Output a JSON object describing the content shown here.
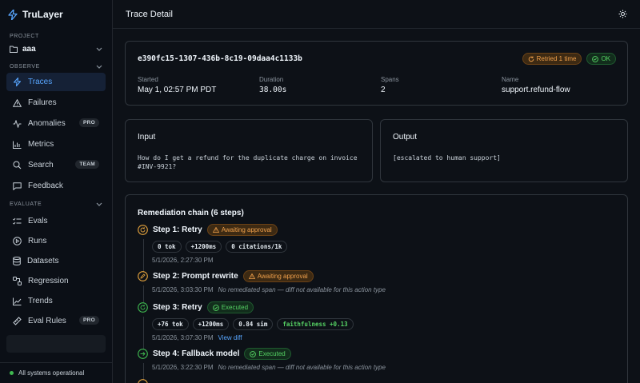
{
  "app": {
    "name": "TruLayer"
  },
  "sidebar": {
    "project_label": "PROJECT",
    "project_name": "aaa",
    "observe_label": "OBSERVE",
    "observe_items": [
      {
        "label": "Traces",
        "icon": "activity-icon"
      },
      {
        "label": "Failures",
        "icon": "warning-icon"
      },
      {
        "label": "Anomalies",
        "icon": "pulse-icon",
        "badge": "PRO"
      },
      {
        "label": "Metrics",
        "icon": "bar-chart-icon"
      },
      {
        "label": "Search",
        "icon": "search-icon",
        "badge": "TEAM"
      },
      {
        "label": "Feedback",
        "icon": "message-icon"
      }
    ],
    "evaluate_label": "EVALUATE",
    "evaluate_items": [
      {
        "label": "Evals",
        "icon": "list-icon"
      },
      {
        "label": "Runs",
        "icon": "play-icon"
      },
      {
        "label": "Datasets",
        "icon": "database-icon"
      },
      {
        "label": "Regression",
        "icon": "regression-icon"
      },
      {
        "label": "Trends",
        "icon": "trend-icon"
      },
      {
        "label": "Eval Rules",
        "icon": "ruler-icon",
        "badge": "PRO"
      }
    ],
    "status": "All systems operational"
  },
  "header": {
    "title": "Trace Detail",
    "theme_icon": "sun-icon"
  },
  "trace": {
    "id": "e390fc15-1307-436b-8c19-09daa4c1133b",
    "retried_badge": "Retried 1 time",
    "ok_badge": "OK",
    "started_label": "Started",
    "started_value": "May 1, 02:57 PM PDT",
    "duration_label": "Duration",
    "duration_value": "38.00s",
    "spans_label": "Spans",
    "spans_value": "2",
    "name_label": "Name",
    "name_value": "support.refund-flow"
  },
  "io": {
    "input_title": "Input",
    "input_text": "How do I get a refund for the duplicate charge on invoice #INV-9921?",
    "output_title": "Output",
    "output_text": "[escalated to human support]"
  },
  "chain": {
    "title": "Remediation chain (6 steps)",
    "steps": [
      {
        "name": "Step 1: Retry",
        "status": "Awaiting approval",
        "chips": [
          "0 tok",
          "+1200ms",
          "0 citations/1k"
        ],
        "time": "5/1/2026, 2:27:30 PM"
      },
      {
        "name": "Step 2: Prompt rewrite",
        "status": "Awaiting approval",
        "time": "5/1/2026, 3:03:30 PM",
        "note": "No remediated span — diff not available for this action type"
      },
      {
        "name": "Step 3: Retry",
        "status": "Executed",
        "chips": [
          "+76 tok",
          "+1200ms",
          "0.84 sim",
          "faithfulness +0.13"
        ],
        "time": "5/1/2026, 3:07:30 PM",
        "link": "View diff"
      },
      {
        "name": "Step 4: Fallback model",
        "status": "Executed",
        "time": "5/1/2026, 3:22:30 PM",
        "note": "No remediated span — diff not available for this action type"
      }
    ]
  }
}
